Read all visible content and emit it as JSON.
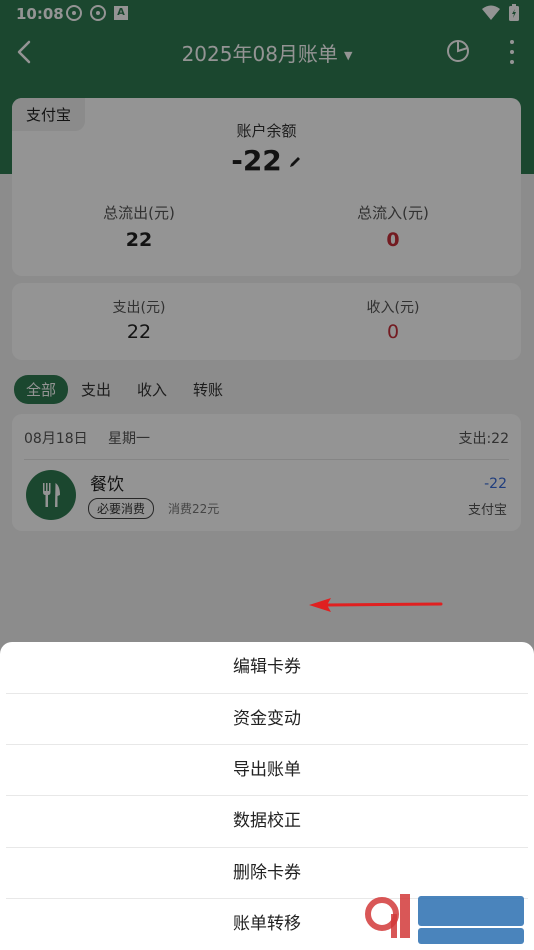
{
  "status_bar": {
    "time": "10:08"
  },
  "header": {
    "title": "2025年08月账单"
  },
  "balance_card": {
    "account_tag": "支付宝",
    "balance_label": "账户余额",
    "balance_value": "-22",
    "total_out_label": "总流出(元)",
    "total_out_value": "22",
    "total_in_label": "总流入(元)",
    "total_in_value": "0"
  },
  "period_card": {
    "expense_label": "支出(元)",
    "expense_value": "22",
    "income_label": "收入(元)",
    "income_value": "0"
  },
  "tabs": [
    "全部",
    "支出",
    "收入",
    "转账"
  ],
  "transactions": {
    "date": "08月18日",
    "weekday": "星期一",
    "day_total": "支出:22",
    "items": [
      {
        "category": "餐饮",
        "tag": "必要消费",
        "note": "消费22元",
        "amount": "-22",
        "account": "支付宝"
      }
    ]
  },
  "sheet": {
    "items": [
      "编辑卡券",
      "资金变动",
      "导出账单",
      "数据校正",
      "删除卡券",
      "账单转移"
    ]
  },
  "colors": {
    "brand_green": "#2f7a52",
    "expense_red": "#c62f3a",
    "amount_blue": "#3a6bd8"
  }
}
